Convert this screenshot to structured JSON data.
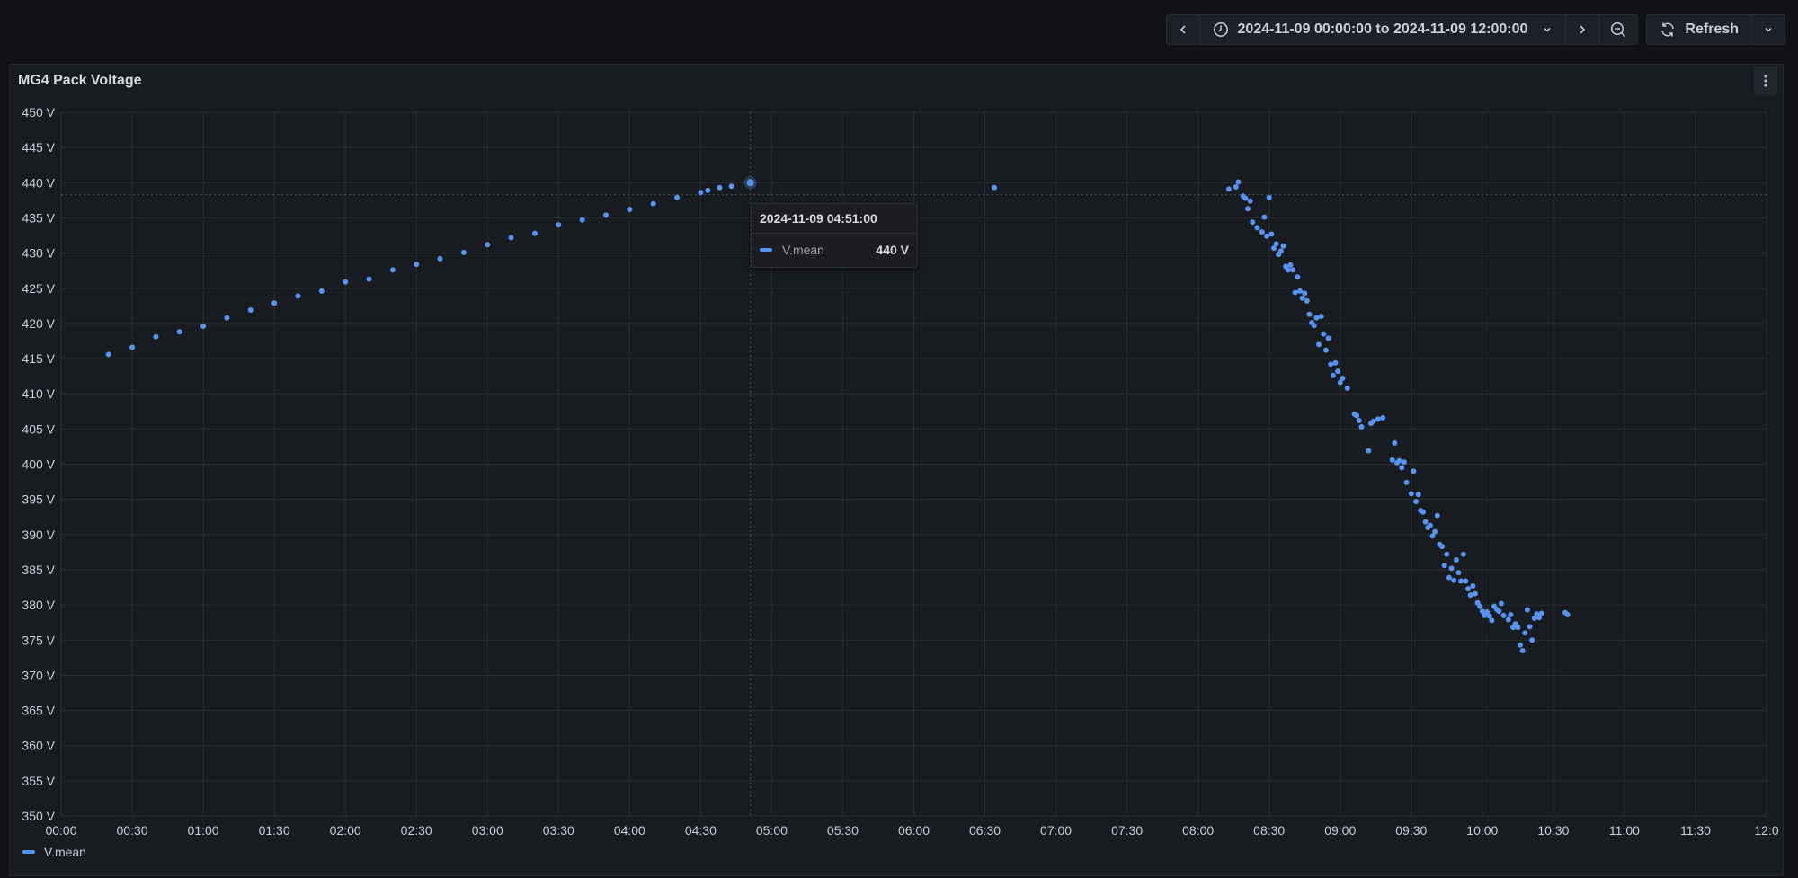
{
  "toolbar": {
    "time_range": "2024-11-09 00:00:00 to 2024-11-09 12:00:00",
    "refresh_label": "Refresh",
    "icons": [
      "chevron-left-icon",
      "clock-icon",
      "chevron-down-icon",
      "chevron-right-icon",
      "zoom-out-icon",
      "refresh-icon",
      "chevron-down-icon"
    ]
  },
  "panel": {
    "title": "MG4 Pack Voltage",
    "menu_icon": "vertical-ellipsis-icon",
    "legend": [
      {
        "name": "V.mean",
        "color": "#5794f2"
      }
    ]
  },
  "tooltip": {
    "time": "2024-11-09 04:51:00",
    "series": "V.mean",
    "value": "440 V"
  },
  "chart_data": {
    "type": "scatter",
    "title": "MG4 Pack Voltage",
    "xlabel": "",
    "ylabel": "",
    "unit": "V",
    "xlim": [
      "00:00",
      "12:00"
    ],
    "ylim": [
      350,
      450
    ],
    "grid": true,
    "legend_position": "bottom-left",
    "x_ticks": [
      "00:00",
      "00:30",
      "01:00",
      "01:30",
      "02:00",
      "02:30",
      "03:00",
      "03:30",
      "04:00",
      "04:30",
      "05:00",
      "05:30",
      "06:00",
      "06:30",
      "07:00",
      "07:30",
      "08:00",
      "08:30",
      "09:00",
      "09:30",
      "10:00",
      "10:30",
      "11:00",
      "11:30",
      "12:0"
    ],
    "y_ticks": [
      "450 V",
      "445 V",
      "440 V",
      "435 V",
      "430 V",
      "425 V",
      "420 V",
      "415 V",
      "410 V",
      "405 V",
      "400 V",
      "395 V",
      "390 V",
      "385 V",
      "380 V",
      "375 V",
      "370 V",
      "365 V",
      "360 V",
      "355 V",
      "350 V"
    ],
    "highlight": {
      "x": "04:51",
      "y": 440
    },
    "crosshair_y": 438.3,
    "series": [
      {
        "name": "V.mean",
        "color": "#5794f2",
        "points": [
          [
            "00:20",
            415.6
          ],
          [
            "00:30",
            416.6
          ],
          [
            "00:40",
            418.1
          ],
          [
            "00:50",
            418.8
          ],
          [
            "01:00",
            419.6
          ],
          [
            "01:10",
            420.8
          ],
          [
            "01:20",
            421.9
          ],
          [
            "01:30",
            422.9
          ],
          [
            "01:40",
            423.9
          ],
          [
            "01:50",
            424.6
          ],
          [
            "02:00",
            425.9
          ],
          [
            "02:10",
            426.3
          ],
          [
            "02:20",
            427.6
          ],
          [
            "02:30",
            428.4
          ],
          [
            "02:40",
            429.2
          ],
          [
            "02:50",
            430.1
          ],
          [
            "03:00",
            431.2
          ],
          [
            "03:10",
            432.2
          ],
          [
            "03:20",
            432.8
          ],
          [
            "03:30",
            434.0
          ],
          [
            "03:40",
            434.7
          ],
          [
            "03:50",
            435.4
          ],
          [
            "04:00",
            436.2
          ],
          [
            "04:10",
            437.0
          ],
          [
            "04:20",
            437.9
          ],
          [
            "04:30",
            438.6
          ],
          [
            "04:33",
            438.9
          ],
          [
            "04:38",
            439.3
          ],
          [
            "04:43",
            439.5
          ],
          [
            "04:51",
            440.0
          ],
          [
            "06:34",
            439.3
          ],
          [
            "08:13",
            439.1
          ],
          [
            "08:16",
            439.4
          ],
          [
            "08:17",
            440.1
          ],
          [
            "08:19",
            438.1
          ],
          [
            "08:20",
            437.8
          ],
          [
            "08:22",
            437.4
          ],
          [
            "08:21",
            436.3
          ],
          [
            "08:23",
            434.4
          ],
          [
            "08:25",
            433.6
          ],
          [
            "08:27",
            433.0
          ],
          [
            "08:28",
            435.1
          ],
          [
            "08:29",
            432.4
          ],
          [
            "08:30",
            437.9
          ],
          [
            "08:31",
            432.7
          ],
          [
            "08:32",
            430.7
          ],
          [
            "08:33",
            431.3
          ],
          [
            "08:34",
            429.8
          ],
          [
            "08:35",
            430.3
          ],
          [
            "08:36",
            431.0
          ],
          [
            "08:37",
            428.1
          ],
          [
            "08:38",
            427.6
          ],
          [
            "08:39",
            428.3
          ],
          [
            "08:40",
            427.6
          ],
          [
            "08:41",
            424.4
          ],
          [
            "08:42",
            426.6
          ],
          [
            "08:43",
            424.6
          ],
          [
            "08:44",
            423.6
          ],
          [
            "08:45",
            424.3
          ],
          [
            "08:46",
            423.2
          ],
          [
            "08:47",
            421.3
          ],
          [
            "08:48",
            420.1
          ],
          [
            "08:49",
            419.7
          ],
          [
            "08:50",
            420.8
          ],
          [
            "08:51",
            417.0
          ],
          [
            "08:52",
            421.0
          ],
          [
            "08:53",
            418.5
          ],
          [
            "08:54",
            416.2
          ],
          [
            "08:55",
            417.9
          ],
          [
            "08:56",
            414.2
          ],
          [
            "08:57",
            412.6
          ],
          [
            "08:58",
            414.4
          ],
          [
            "08:59",
            413.2
          ],
          [
            "09:00",
            411.6
          ],
          [
            "09:01",
            412.2
          ],
          [
            "09:03",
            410.8
          ],
          [
            "09:06",
            407.1
          ],
          [
            "09:07",
            406.9
          ],
          [
            "09:08",
            406.2
          ],
          [
            "09:09",
            405.3
          ],
          [
            "09:12",
            401.9
          ],
          [
            "09:13",
            405.8
          ],
          [
            "09:14",
            406.1
          ],
          [
            "09:16",
            406.4
          ],
          [
            "09:18",
            406.6
          ],
          [
            "09:22",
            400.6
          ],
          [
            "09:23",
            403.0
          ],
          [
            "09:24",
            400.2
          ],
          [
            "09:25",
            400.5
          ],
          [
            "09:26",
            399.5
          ],
          [
            "09:27",
            400.3
          ],
          [
            "09:28",
            397.4
          ],
          [
            "09:30",
            395.8
          ],
          [
            "09:31",
            399.0
          ],
          [
            "09:32",
            394.7
          ],
          [
            "09:33",
            395.7
          ],
          [
            "09:34",
            393.4
          ],
          [
            "09:35",
            393.2
          ],
          [
            "09:36",
            391.8
          ],
          [
            "09:37",
            391.0
          ],
          [
            "09:38",
            391.3
          ],
          [
            "09:39",
            389.8
          ],
          [
            "09:40",
            390.4
          ],
          [
            "09:41",
            392.7
          ],
          [
            "09:42",
            388.6
          ],
          [
            "09:43",
            388.3
          ],
          [
            "09:44",
            385.6
          ],
          [
            "09:45",
            387.2
          ],
          [
            "09:46",
            383.9
          ],
          [
            "09:47",
            385.2
          ],
          [
            "09:48",
            383.5
          ],
          [
            "09:49",
            386.4
          ],
          [
            "09:50",
            384.6
          ],
          [
            "09:51",
            383.4
          ],
          [
            "09:52",
            387.2
          ],
          [
            "09:53",
            383.4
          ],
          [
            "09:54",
            382.3
          ],
          [
            "09:55",
            381.4
          ],
          [
            "09:56",
            382.7
          ],
          [
            "09:57",
            381.6
          ],
          [
            "09:58",
            380.3
          ],
          [
            "09:59",
            379.8
          ],
          [
            "10:00",
            379.1
          ],
          [
            "10:01",
            378.5
          ],
          [
            "10:02",
            379.0
          ],
          [
            "10:03",
            378.4
          ],
          [
            "10:04",
            377.8
          ],
          [
            "10:05",
            379.8
          ],
          [
            "10:06",
            379.4
          ],
          [
            "10:07",
            379.1
          ],
          [
            "10:08",
            380.2
          ],
          [
            "10:09",
            378.5
          ],
          [
            "10:11",
            377.9
          ],
          [
            "10:12",
            378.6
          ],
          [
            "10:13",
            376.8
          ],
          [
            "10:14",
            377.3
          ],
          [
            "10:15",
            376.8
          ],
          [
            "10:16",
            374.3
          ],
          [
            "10:17",
            373.5
          ],
          [
            "10:18",
            376.0
          ],
          [
            "10:19",
            379.3
          ],
          [
            "10:20",
            376.9
          ],
          [
            "10:21",
            375.0
          ],
          [
            "10:22",
            378.1
          ],
          [
            "10:23",
            378.7
          ],
          [
            "10:24",
            378.2
          ],
          [
            "10:25",
            378.8
          ],
          [
            "10:35",
            378.9
          ],
          [
            "10:36",
            378.6
          ]
        ]
      }
    ]
  }
}
